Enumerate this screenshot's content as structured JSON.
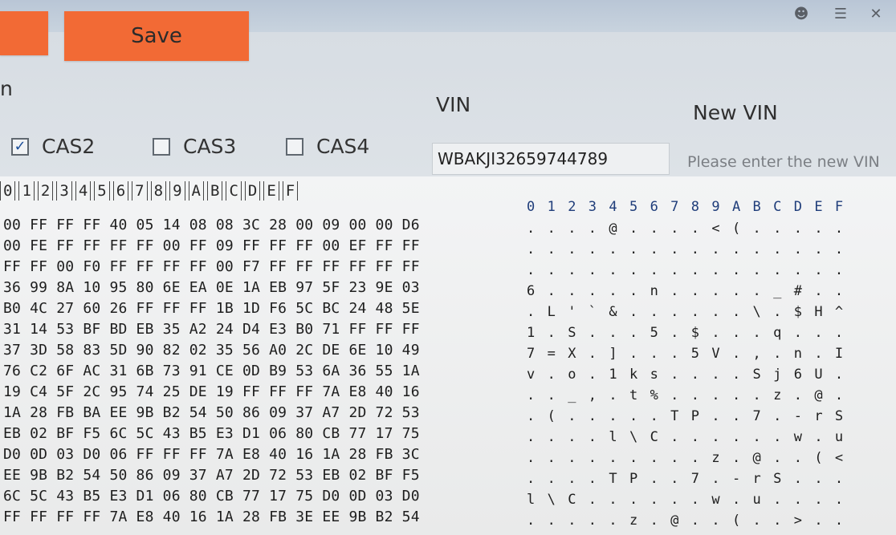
{
  "toolbar": {
    "left_button_label": "",
    "save_label": "Save"
  },
  "form": {
    "partial_label": "n",
    "vin_label": "VIN",
    "new_vin_label": "New VIN",
    "vin_value": "WBAKJI32659744789",
    "new_vin_placeholder": "Please enter the new VIN",
    "checkboxes": [
      {
        "label": "CAS2",
        "checked": true
      },
      {
        "label": "CAS3",
        "checked": false
      },
      {
        "label": "CAS4",
        "checked": false
      }
    ]
  },
  "hex_view": {
    "column_headers": [
      "0",
      "1",
      "2",
      "3",
      "4",
      "5",
      "6",
      "7",
      "8",
      "9",
      "A",
      "B",
      "C",
      "D",
      "E",
      "F"
    ],
    "ascii_headers": [
      "0",
      "1",
      "2",
      "3",
      "4",
      "5",
      "6",
      "7",
      "8",
      "9",
      "A",
      "B",
      "C",
      "D",
      "E",
      "F"
    ],
    "rows": [
      "00 FF FF FF 40 05 14 08 08 3C 28 00 09 00 00 D6",
      "00 FE FF FF FF FF 00 FF 09 FF FF FF 00 EF FF FF",
      "FF FF 00 F0 FF FF FF FF 00 F7 FF FF FF FF FF FF",
      "36 99 8A 10 95 80 6E EA 0E 1A EB 97 5F 23 9E 03",
      "B0 4C 27 60 26 FF FF FF 1B 1D F6 5C BC 24 48 5E",
      "31 14 53 BF BD EB 35 A2 24 D4 E3 B0 71 FF FF FF",
      "37 3D 58 83 5D 90 82 02 35 56 A0 2C DE 6E 10 49",
      "76 C2 6F AC 31 6B 73 91 CE 0D B9 53 6A 36 55 1A",
      "19 C4 5F 2C 95 74 25 DE 19 FF FF FF 7A E8 40 16",
      "1A 28 FB BA EE 9B B2 54 50 86 09 37 A7 2D 72 53",
      "EB 02 BF F5 6C 5C 43 B5 E3 D1 06 80 CB 77 17 75",
      "D0 0D 03 D0 06 FF FF FF 7A E8 40 16 1A 28 FB 3C",
      "EE 9B B2 54 50 86 09 37 A7 2D 72 53 EB 02 BF F5",
      "6C 5C 43 B5 E3 D1 06 80 CB 77 17 75 D0 0D 03 D0",
      "FF FF FF FF 7A E8 40 16 1A 28 FB 3E EE 9B B2 54"
    ],
    "ascii_rows": [
      [
        ".",
        ".",
        ".",
        ".",
        "@",
        ".",
        ".",
        ".",
        ".",
        "<",
        "(",
        ".",
        ".",
        ".",
        ".",
        "."
      ],
      [
        ".",
        ".",
        ".",
        ".",
        ".",
        ".",
        ".",
        ".",
        ".",
        ".",
        ".",
        ".",
        ".",
        ".",
        ".",
        "."
      ],
      [
        ".",
        ".",
        ".",
        ".",
        ".",
        ".",
        ".",
        ".",
        ".",
        ".",
        ".",
        ".",
        ".",
        ".",
        ".",
        "."
      ],
      [
        "6",
        ".",
        ".",
        ".",
        ".",
        ".",
        "n",
        ".",
        ".",
        ".",
        ".",
        ".",
        "_",
        "#",
        ".",
        "."
      ],
      [
        ".",
        "L",
        "'",
        "`",
        "&",
        ".",
        ".",
        ".",
        ".",
        ".",
        ".",
        "\\",
        ".",
        "$",
        "H",
        "^"
      ],
      [
        "1",
        ".",
        "S",
        ".",
        ".",
        ".",
        "5",
        ".",
        "$",
        ".",
        ".",
        ".",
        "q",
        ".",
        ".",
        "."
      ],
      [
        "7",
        "=",
        "X",
        ".",
        "]",
        ".",
        ".",
        ".",
        "5",
        "V",
        ".",
        ",",
        ".",
        "n",
        ".",
        "I"
      ],
      [
        "v",
        ".",
        "o",
        ".",
        "1",
        "k",
        "s",
        ".",
        ".",
        ".",
        ".",
        "S",
        "j",
        "6",
        "U",
        "."
      ],
      [
        ".",
        ".",
        "_",
        ",",
        ".",
        "t",
        "%",
        ".",
        ".",
        ".",
        ".",
        ".",
        "z",
        ".",
        "@",
        "."
      ],
      [
        ".",
        "(",
        ".",
        ".",
        ".",
        ".",
        ".",
        "T",
        "P",
        ".",
        ".",
        "7",
        ".",
        "-",
        "r",
        "S"
      ],
      [
        ".",
        ".",
        ".",
        ".",
        "l",
        "\\",
        "C",
        ".",
        ".",
        ".",
        ".",
        ".",
        ".",
        "w",
        ".",
        "u"
      ],
      [
        ".",
        ".",
        ".",
        ".",
        ".",
        ".",
        ".",
        ".",
        ".",
        "z",
        ".",
        "@",
        ".",
        ".",
        "(",
        "<"
      ],
      [
        ".",
        ".",
        ".",
        ".",
        "T",
        "P",
        ".",
        ".",
        "7",
        ".",
        "-",
        "r",
        "S",
        ".",
        ".",
        "."
      ],
      [
        "l",
        "\\",
        "C",
        ".",
        ".",
        ".",
        ".",
        ".",
        ".",
        "w",
        ".",
        "u",
        ".",
        ".",
        ".",
        "."
      ],
      [
        ".",
        ".",
        ".",
        ".",
        ".",
        "z",
        ".",
        "@",
        ".",
        ".",
        "(",
        ".",
        ".",
        ">",
        ".",
        "."
      ]
    ]
  }
}
